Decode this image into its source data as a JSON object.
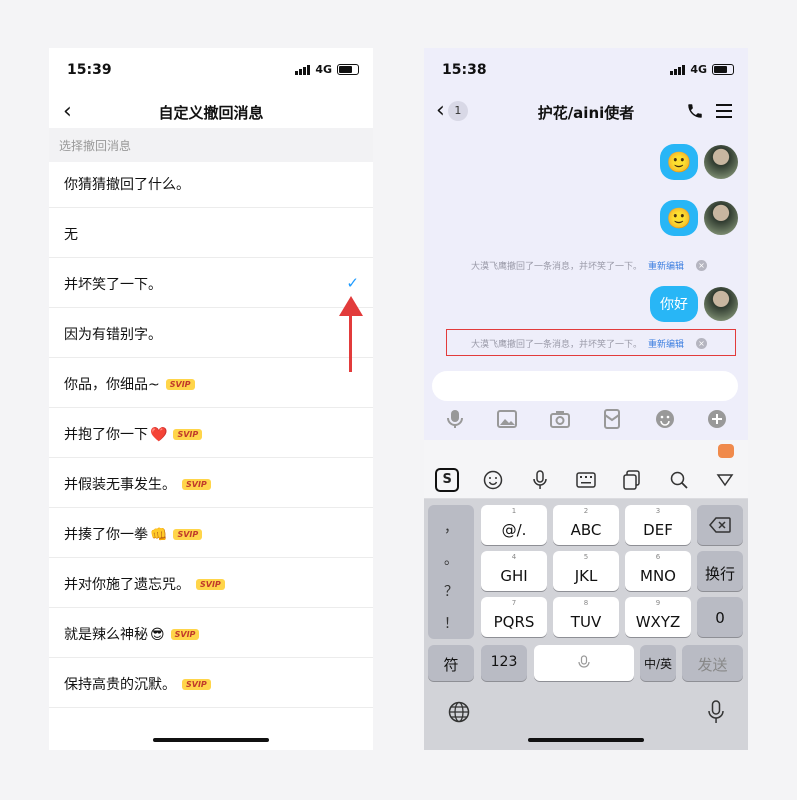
{
  "left": {
    "status": {
      "time": "15:39",
      "network": "4G"
    },
    "title": "自定义撤回消息",
    "section_label": "选择撤回消息",
    "items": [
      {
        "label": "你猜猜撤回了什么。",
        "emoji": "",
        "svip": "",
        "checked": false
      },
      {
        "label": "无",
        "emoji": "",
        "svip": "",
        "checked": false
      },
      {
        "label": "并坏笑了一下。",
        "emoji": "",
        "svip": "",
        "checked": true
      },
      {
        "label": "因为有错别字。",
        "emoji": "",
        "svip": "",
        "checked": false
      },
      {
        "label": "你品，你细品~",
        "emoji": "",
        "svip": "SVIP",
        "checked": false
      },
      {
        "label": "并抱了你一下",
        "emoji": "❤️",
        "svip": "SVIP",
        "checked": false
      },
      {
        "label": "并假装无事发生。",
        "emoji": "",
        "svip": "SVIP",
        "checked": false
      },
      {
        "label": "并揍了你一拳",
        "emoji": "👊",
        "svip": "SVIP",
        "checked": false
      },
      {
        "label": "并对你施了遗忘咒。",
        "emoji": "",
        "svip": "SVIP",
        "checked": false
      },
      {
        "label": "就是辣么神秘",
        "emoji": "😎",
        "svip": "SVIP",
        "checked": false
      },
      {
        "label": "保持高贵的沉默。",
        "emoji": "",
        "svip": "SVIP",
        "checked": false
      }
    ]
  },
  "right": {
    "status": {
      "time": "15:38",
      "network": "4G"
    },
    "unread": "1",
    "title": "护花/aini使者",
    "messages": [
      {
        "content": "🙂"
      },
      {
        "content": "🙂"
      },
      {
        "content": "你好"
      }
    ],
    "recall_notice": {
      "text": "大漠飞鹰撤回了一条消息，并坏笑了一下。",
      "edit": "重新编辑"
    },
    "keyboard": {
      "left_col": [
        "，",
        "。",
        "？",
        "！"
      ],
      "rows": [
        [
          {
            "n": "1",
            "l": "@/."
          },
          {
            "n": "2",
            "l": "ABC"
          },
          {
            "n": "3",
            "l": "DEF"
          }
        ],
        [
          {
            "n": "4",
            "l": "GHI"
          },
          {
            "n": "5",
            "l": "JKL"
          },
          {
            "n": "6",
            "l": "MNO"
          }
        ],
        [
          {
            "n": "7",
            "l": "PQRS"
          },
          {
            "n": "8",
            "l": "TUV"
          },
          {
            "n": "9",
            "l": "WXYZ"
          }
        ]
      ],
      "switch_label": "换行",
      "zero_label": "0",
      "symbol_label": "符",
      "num_label": "123",
      "lang_label": "中/英",
      "send_label": "发送"
    }
  }
}
